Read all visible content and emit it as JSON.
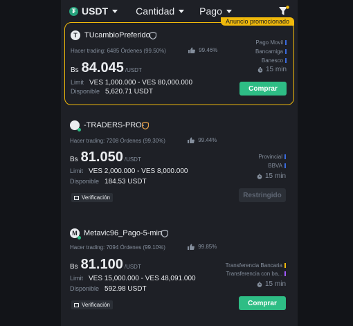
{
  "filters": {
    "asset": "USDT",
    "amount": "Cantidad",
    "payment": "Pago"
  },
  "colors": {
    "accent": "#f0b90b",
    "buy": "#2ebd85",
    "background": "#1e2026"
  },
  "cards": [
    {
      "badge": "Anuncio promocionado",
      "avatar": "T",
      "name": "TUcambioPreferido",
      "trades_label": "Hacer trading:",
      "orders": "6485 Órdenes",
      "completion": "(99.50%)",
      "rating": "99.46%",
      "currency": "Bs",
      "price": "84.045",
      "unit": "/USDT",
      "limit_label": "Limit",
      "limit": "VES 1,000.000 - VES 80,000.000",
      "available_label": "Disponible",
      "available": "5,620.71 USDT",
      "payments": [
        {
          "name": "Pago Movil",
          "color": "#3a6be0"
        },
        {
          "name": "Bancamiga",
          "color": "#3a6be0"
        },
        {
          "name": "Banesco",
          "color": "#3a6be0"
        }
      ],
      "time": "15 min",
      "button": "Comprar"
    },
    {
      "avatar": "",
      "name": "-TRADERS-PRO-",
      "trades_label": "Hacer trading:",
      "orders": "7208 Órdenes",
      "completion": "(99.30%)",
      "rating": "99.44%",
      "currency": "Bs",
      "price": "81.050",
      "unit": "/USDT",
      "limit_label": "Limit",
      "limit": "VES 2,000.000 - VES 8,000.000",
      "available_label": "Disponible",
      "available": "184.53 USDT",
      "payments": [
        {
          "name": "Provincial",
          "color": "#3a6be0"
        },
        {
          "name": "BBVA",
          "color": "#3a6be0"
        }
      ],
      "time": "15 min",
      "button": "Restringido",
      "verification": "Verificación"
    },
    {
      "avatar": "M",
      "name": "Metavic96_Pago-5-min",
      "trades_label": "Hacer trading:",
      "orders": "7094 Órdenes",
      "completion": "(99.10%)",
      "rating": "99.85%",
      "currency": "Bs",
      "price": "81.100",
      "unit": "/USDT",
      "limit_label": "Limit",
      "limit": "VES 15,000.000 - VES 48,091.000",
      "available_label": "Disponible",
      "available": "592.98 USDT",
      "payments": [
        {
          "name": "Transferencia Bancaria",
          "color": "#f0b90b"
        },
        {
          "name": "Transferencia con ba...",
          "color": "#a259ff"
        }
      ],
      "time": "15 min",
      "button": "Comprar",
      "verification": "Verificación"
    }
  ]
}
